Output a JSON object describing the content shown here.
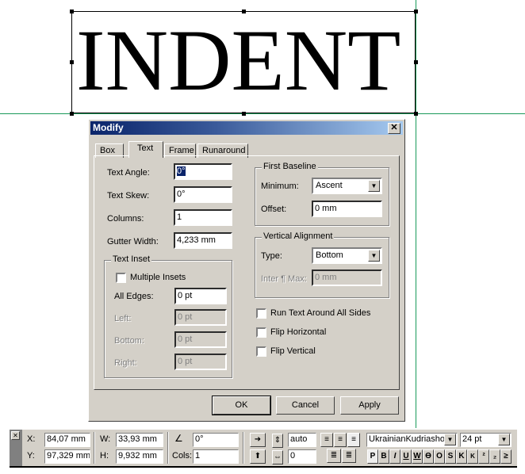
{
  "canvas": {
    "text": "INDENT",
    "guide_color": "#1a9a5a"
  },
  "dialog": {
    "title": "Modify",
    "tabs": [
      {
        "label": "Box"
      },
      {
        "label": "Text"
      },
      {
        "label": "Frame"
      },
      {
        "label": "Runaround"
      }
    ],
    "active_tab": "Text",
    "fields": {
      "text_angle": {
        "label": "Text Angle:",
        "value": "0°"
      },
      "text_skew": {
        "label": "Text Skew:",
        "value": "0°"
      },
      "columns": {
        "label": "Columns:",
        "value": "1"
      },
      "gutter_width": {
        "label": "Gutter Width:",
        "value": "4,233 mm"
      }
    },
    "text_inset": {
      "title": "Text Inset",
      "multiple_insets": "Multiple Insets",
      "all_edges": {
        "label": "All Edges:",
        "value": "0 pt"
      },
      "left": {
        "label": "Left:",
        "value": "0 pt"
      },
      "bottom": {
        "label": "Bottom:",
        "value": "0 pt"
      },
      "right": {
        "label": "Right:",
        "value": "0 pt"
      }
    },
    "first_baseline": {
      "title": "First Baseline",
      "minimum": {
        "label": "Minimum:",
        "value": "Ascent"
      },
      "offset": {
        "label": "Offset:",
        "value": "0 mm"
      }
    },
    "vertical_alignment": {
      "title": "Vertical Alignment",
      "type": {
        "label": "Type:",
        "value": "Bottom"
      },
      "inter_max": {
        "label": "Inter ¶ Max:",
        "value": "0 mm"
      }
    },
    "checkboxes": [
      {
        "label": "Run Text Around All Sides",
        "checked": false
      },
      {
        "label": "Flip Horizontal",
        "checked": false
      },
      {
        "label": "Flip Vertical",
        "checked": false
      }
    ],
    "buttons": {
      "ok": "OK",
      "cancel": "Cancel",
      "apply": "Apply"
    }
  },
  "toolbar": {
    "x": {
      "label": "X:",
      "value": "84,07 mm"
    },
    "y": {
      "label": "Y:",
      "value": "97,329 mm"
    },
    "w": {
      "label": "W:",
      "value": "33,93 mm"
    },
    "h": {
      "label": "H:",
      "value": "9,932 mm"
    },
    "angle": {
      "value": "0°"
    },
    "cols": {
      "label": "Cols:",
      "value": "1"
    },
    "leading": "auto",
    "tracking": "0",
    "font": "UkrainianKudriasho",
    "size": "24 pt",
    "styles": [
      "P",
      "B",
      "I",
      "U",
      "W",
      "Ө",
      "O",
      "S",
      "K",
      "K",
      "²",
      "₂",
      "≥"
    ]
  }
}
